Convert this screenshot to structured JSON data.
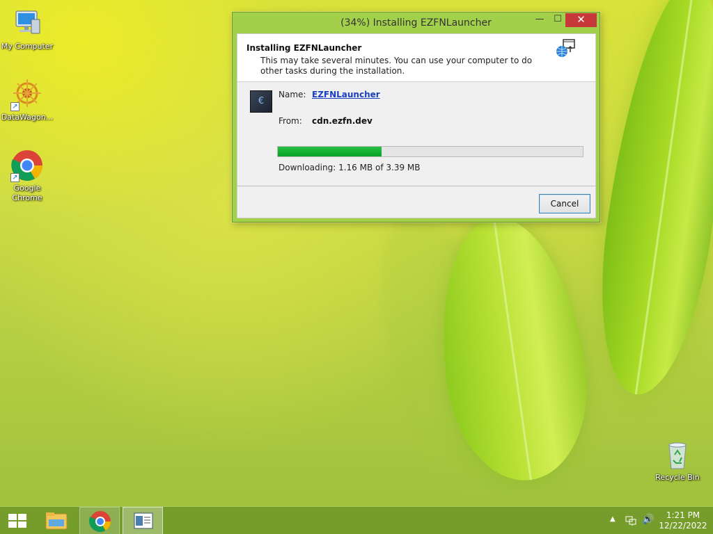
{
  "desktop": {
    "icons": [
      {
        "label": "My Computer"
      },
      {
        "label": "DataWagon..."
      },
      {
        "label": "Google Chrome"
      }
    ],
    "recycle_bin": "Recycle Bin"
  },
  "dialog": {
    "title": "(34%) Installing EZFNLauncher",
    "controls": {
      "minimize": "—",
      "maximize": "☐",
      "close": "✕"
    },
    "header_title": "Installing EZFNLauncher",
    "header_subtitle": "This may take several minutes. You can use your computer to do other tasks during the installation.",
    "name_label": "Name:",
    "name_value": "EZFNLauncher",
    "from_label": "From:",
    "from_value": "cdn.ezfn.dev",
    "progress": 0.34,
    "progress_color": "#06a325",
    "download_text": "Downloading: 1.16 MB of 3.39 MB",
    "cancel_label": "Cancel"
  },
  "taskbar": {
    "clock_time": "1:21 PM",
    "clock_date": "12/22/2022",
    "tray_arrow": "▲",
    "volume_icon": "🔊"
  }
}
